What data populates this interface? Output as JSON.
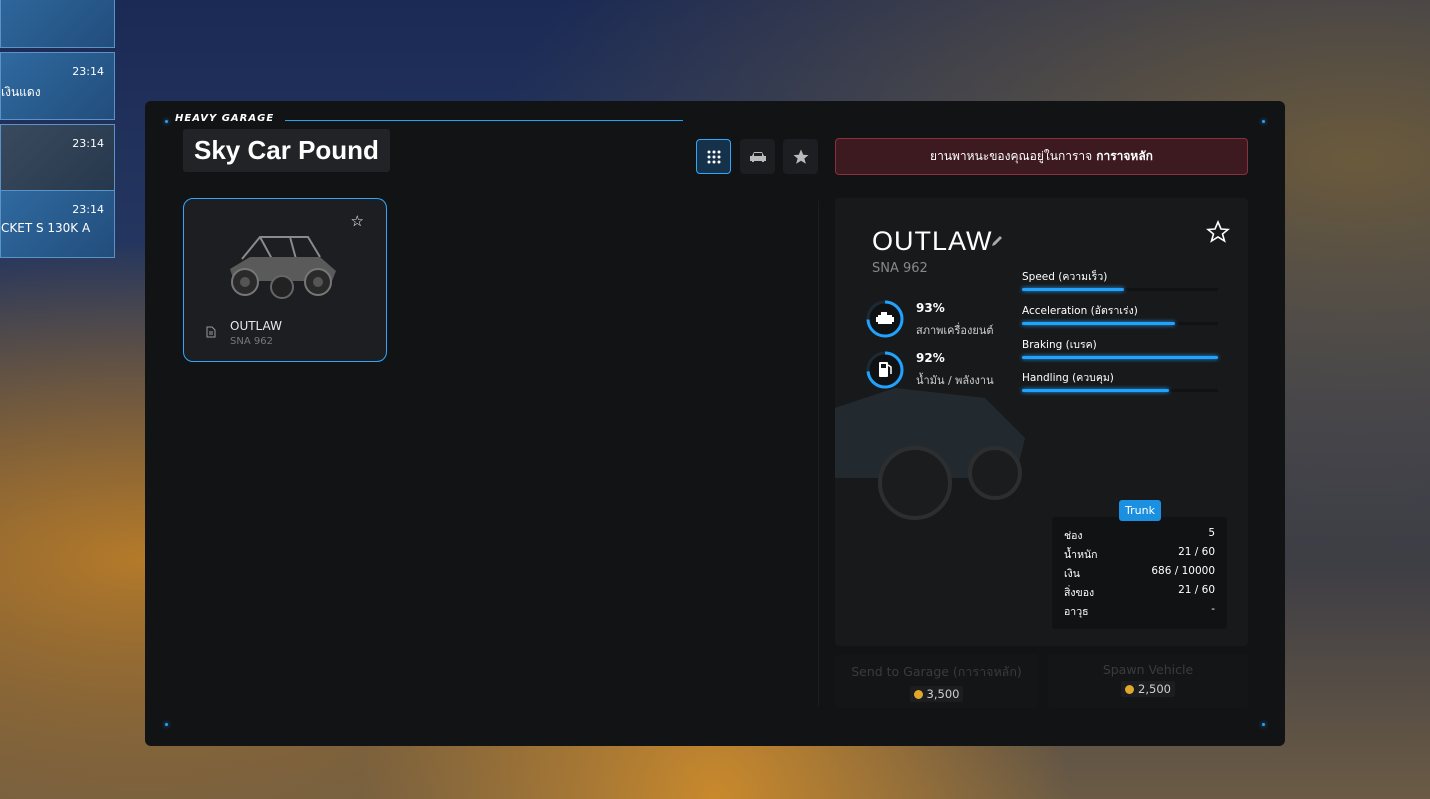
{
  "feed": [
    {
      "time": "",
      "message": ""
    },
    {
      "time": "23:14",
      "message": "เงินแดง"
    },
    {
      "time": "23:14",
      "message": ""
    },
    {
      "time": "23:14",
      "message": "CKET S 130K A"
    }
  ],
  "header": {
    "brand": "HEAVY GARAGE",
    "title": "Sky Car Pound",
    "notice_text": "ยานพาหนะของคุณอยู่ในการาจ",
    "notice_highlight": "การาจหลัก"
  },
  "view_buttons": [
    {
      "icon": "grid-icon",
      "active": true
    },
    {
      "icon": "car-icon",
      "active": false
    },
    {
      "icon": "star-icon",
      "active": false
    }
  ],
  "vehicles": [
    {
      "name": "OUTLAW",
      "plate": "SNA 962",
      "favorite": false
    }
  ],
  "detail": {
    "name": "OUTLAW",
    "plate": "SNA 962",
    "engine": {
      "value": "93%",
      "label": "สภาพเครื่องยนต์",
      "fraction": 0.93
    },
    "fuel": {
      "value": "92%",
      "label": "น้ำมัน / พลังงาน",
      "fraction": 0.92
    },
    "stats": [
      {
        "label": "Speed (ความเร็ว)",
        "fraction": 0.52
      },
      {
        "label": "Acceleration (อัตราเร่ง)",
        "fraction": 0.78
      },
      {
        "label": "Braking (เบรค)",
        "fraction": 1.0
      },
      {
        "label": "Handling (ควบคุม)",
        "fraction": 0.75
      }
    ],
    "trunk": {
      "badge": "Trunk",
      "rows": [
        {
          "key": "ช่อง",
          "value": "5"
        },
        {
          "key": "น้ำหนัก",
          "value": "21 / 60"
        },
        {
          "key": "เงิน",
          "value": "686 / 10000"
        },
        {
          "key": "สิ่งของ",
          "value": "21 / 60"
        },
        {
          "key": "อาวุธ",
          "value": "-"
        }
      ]
    }
  },
  "actions": {
    "send_label": "Send to Garage (การาจหลัก)",
    "send_price": "3,500",
    "spawn_label": "Spawn Vehicle",
    "spawn_price": "2,500"
  },
  "colors": {
    "accent": "#1fa3ff",
    "panel": "#121315",
    "notice_bg": "#3c1a20",
    "coin": "#e0a72a"
  }
}
